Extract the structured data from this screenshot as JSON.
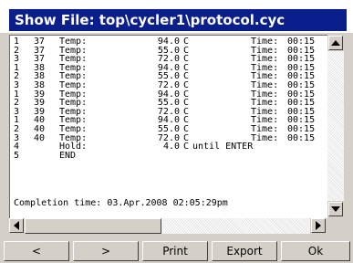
{
  "window": {
    "title": "Show File: top\\cycler1\\protocol.cyc"
  },
  "file_lines": [
    {
      "num": "1",
      "cycle": "37",
      "label": "Temp:",
      "value": "94.0",
      "unit": "C",
      "suffix": "",
      "time_label": "Time:",
      "time": "00:15"
    },
    {
      "num": "2",
      "cycle": "37",
      "label": "Temp:",
      "value": "55.0",
      "unit": "C",
      "suffix": "",
      "time_label": "Time:",
      "time": "00:15"
    },
    {
      "num": "3",
      "cycle": "37",
      "label": "Temp:",
      "value": "72.0",
      "unit": "C",
      "suffix": "",
      "time_label": "Time:",
      "time": "00:15"
    },
    {
      "num": "1",
      "cycle": "38",
      "label": "Temp:",
      "value": "94.0",
      "unit": "C",
      "suffix": "",
      "time_label": "Time:",
      "time": "00:15"
    },
    {
      "num": "2",
      "cycle": "38",
      "label": "Temp:",
      "value": "55.0",
      "unit": "C",
      "suffix": "",
      "time_label": "Time:",
      "time": "00:15"
    },
    {
      "num": "3",
      "cycle": "38",
      "label": "Temp:",
      "value": "72.0",
      "unit": "C",
      "suffix": "",
      "time_label": "Time:",
      "time": "00:15"
    },
    {
      "num": "1",
      "cycle": "39",
      "label": "Temp:",
      "value": "94.0",
      "unit": "C",
      "suffix": "",
      "time_label": "Time:",
      "time": "00:15"
    },
    {
      "num": "2",
      "cycle": "39",
      "label": "Temp:",
      "value": "55.0",
      "unit": "C",
      "suffix": "",
      "time_label": "Time:",
      "time": "00:15"
    },
    {
      "num": "3",
      "cycle": "39",
      "label": "Temp:",
      "value": "72.0",
      "unit": "C",
      "suffix": "",
      "time_label": "Time:",
      "time": "00:15"
    },
    {
      "num": "1",
      "cycle": "40",
      "label": "Temp:",
      "value": "94.0",
      "unit": "C",
      "suffix": "",
      "time_label": "Time:",
      "time": "00:15"
    },
    {
      "num": "2",
      "cycle": "40",
      "label": "Temp:",
      "value": "55.0",
      "unit": "C",
      "suffix": "",
      "time_label": "Time:",
      "time": "00:15"
    },
    {
      "num": "3",
      "cycle": "40",
      "label": "Temp:",
      "value": "72.0",
      "unit": "C",
      "suffix": "",
      "time_label": "Time:",
      "time": "00:15"
    },
    {
      "num": "4",
      "cycle": "",
      "label": "Hold:",
      "value": "4.0",
      "unit": "C",
      "suffix": "until ENTER",
      "time_label": "",
      "time": ""
    },
    {
      "num": "5",
      "cycle": "",
      "label": "END",
      "value": "",
      "unit": "",
      "suffix": "",
      "time_label": "",
      "time": ""
    }
  ],
  "completion": {
    "text": "Completion time: 03.Apr.2008 02:05:29pm"
  },
  "buttons": {
    "prev": "<",
    "next": ">",
    "print": "Print",
    "export": "Export",
    "ok": "Ok"
  },
  "colors": {
    "title_bar": "#0a1e8c",
    "face": "#d4d0c8",
    "text_bg": "#ffffff"
  },
  "icons": {
    "scroll_up": "scroll-up-arrow-icon",
    "scroll_down": "scroll-down-arrow-icon",
    "scroll_left": "scroll-left-arrow-icon",
    "scroll_right": "scroll-right-arrow-icon"
  }
}
